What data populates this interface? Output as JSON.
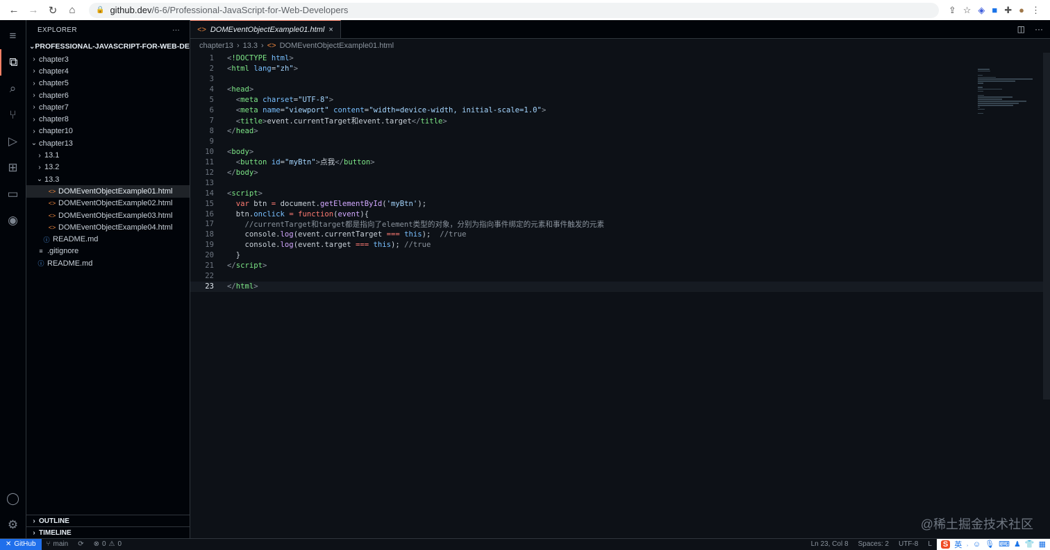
{
  "browser": {
    "url_host": "github.dev",
    "url_path": "/6-6/Professional-JavaScript-for-Web-Developers"
  },
  "sidebar": {
    "title": "EXPLORER",
    "more": "···",
    "root": "PROFESSIONAL-JAVASCRIPT-FOR-WEB-DEVE...",
    "items": [
      {
        "label": "chapter3",
        "type": "folder",
        "open": false,
        "depth": 1
      },
      {
        "label": "chapter4",
        "type": "folder",
        "open": false,
        "depth": 1
      },
      {
        "label": "chapter5",
        "type": "folder",
        "open": false,
        "depth": 1
      },
      {
        "label": "chapter6",
        "type": "folder",
        "open": false,
        "depth": 1
      },
      {
        "label": "chapter7",
        "type": "folder",
        "open": false,
        "depth": 1
      },
      {
        "label": "chapter8",
        "type": "folder",
        "open": false,
        "depth": 1
      },
      {
        "label": "chapter10",
        "type": "folder",
        "open": false,
        "depth": 1
      },
      {
        "label": "chapter13",
        "type": "folder",
        "open": true,
        "depth": 1
      },
      {
        "label": "13.1",
        "type": "folder",
        "open": false,
        "depth": 2
      },
      {
        "label": "13.2",
        "type": "folder",
        "open": false,
        "depth": 2
      },
      {
        "label": "13.3",
        "type": "folder",
        "open": true,
        "depth": 2
      },
      {
        "label": "DOMEventObjectExample01.html",
        "type": "html",
        "depth": 3,
        "selected": true
      },
      {
        "label": "DOMEventObjectExample02.html",
        "type": "html",
        "depth": 3
      },
      {
        "label": "DOMEventObjectExample03.html",
        "type": "html",
        "depth": 3
      },
      {
        "label": "DOMEventObjectExample04.html",
        "type": "html",
        "depth": 3
      },
      {
        "label": "README.md",
        "type": "info",
        "depth": 2
      },
      {
        "label": ".gitignore",
        "type": "lines",
        "depth": 1
      },
      {
        "label": "README.md",
        "type": "info",
        "depth": 1
      }
    ],
    "outline": "OUTLINE",
    "timeline": "TIMELINE"
  },
  "editor": {
    "tab": "DOMEventObjectExample01.html",
    "breadcrumbs": [
      "chapter13",
      "13.3",
      "DOMEventObjectExample01.html"
    ],
    "current_line": 23,
    "lines": [
      [
        [
          "br",
          "<"
        ],
        [
          "tag",
          "!DOCTYPE"
        ],
        [
          "p",
          " "
        ],
        [
          "attr",
          "html"
        ],
        [
          "br",
          ">"
        ]
      ],
      [
        [
          "br",
          "<"
        ],
        [
          "tag",
          "html"
        ],
        [
          "p",
          " "
        ],
        [
          "attr",
          "lang"
        ],
        [
          "p",
          "="
        ],
        [
          "str",
          "\"zh\""
        ],
        [
          "br",
          ">"
        ]
      ],
      [],
      [
        [
          "br",
          "<"
        ],
        [
          "tag",
          "head"
        ],
        [
          "br",
          ">"
        ]
      ],
      [
        [
          "p",
          "  "
        ],
        [
          "br",
          "<"
        ],
        [
          "tag",
          "meta"
        ],
        [
          "p",
          " "
        ],
        [
          "attr",
          "charset"
        ],
        [
          "p",
          "="
        ],
        [
          "str",
          "\"UTF-8\""
        ],
        [
          "br",
          ">"
        ]
      ],
      [
        [
          "p",
          "  "
        ],
        [
          "br",
          "<"
        ],
        [
          "tag",
          "meta"
        ],
        [
          "p",
          " "
        ],
        [
          "attr",
          "name"
        ],
        [
          "p",
          "="
        ],
        [
          "str",
          "\"viewport\""
        ],
        [
          "p",
          " "
        ],
        [
          "attr",
          "content"
        ],
        [
          "p",
          "="
        ],
        [
          "str",
          "\"width=device-width, initial-scale=1.0\""
        ],
        [
          "br",
          ">"
        ]
      ],
      [
        [
          "p",
          "  "
        ],
        [
          "br",
          "<"
        ],
        [
          "tag",
          "title"
        ],
        [
          "br",
          ">"
        ],
        [
          "p",
          "event.currentTarget和event.target"
        ],
        [
          "br",
          "</"
        ],
        [
          "tag",
          "title"
        ],
        [
          "br",
          ">"
        ]
      ],
      [
        [
          "br",
          "</"
        ],
        [
          "tag",
          "head"
        ],
        [
          "br",
          ">"
        ]
      ],
      [],
      [
        [
          "br",
          "<"
        ],
        [
          "tag",
          "body"
        ],
        [
          "br",
          ">"
        ]
      ],
      [
        [
          "p",
          "  "
        ],
        [
          "br",
          "<"
        ],
        [
          "tag",
          "button"
        ],
        [
          "p",
          " "
        ],
        [
          "attr",
          "id"
        ],
        [
          "p",
          "="
        ],
        [
          "str",
          "\"myBtn\""
        ],
        [
          "br",
          ">"
        ],
        [
          "p",
          "点我"
        ],
        [
          "br",
          "</"
        ],
        [
          "tag",
          "button"
        ],
        [
          "br",
          ">"
        ]
      ],
      [
        [
          "br",
          "</"
        ],
        [
          "tag",
          "body"
        ],
        [
          "br",
          ">"
        ]
      ],
      [],
      [
        [
          "br",
          "<"
        ],
        [
          "tag",
          "script"
        ],
        [
          "br",
          ">"
        ]
      ],
      [
        [
          "p",
          "  "
        ],
        [
          "kw",
          "var"
        ],
        [
          "p",
          " btn "
        ],
        [
          "kw",
          "="
        ],
        [
          "p",
          " document."
        ],
        [
          "fn",
          "getElementById"
        ],
        [
          "p",
          "("
        ],
        [
          "str",
          "'myBtn'"
        ],
        [
          "p",
          ");"
        ]
      ],
      [
        [
          "p",
          "  btn."
        ],
        [
          "attr",
          "onclick"
        ],
        [
          "p",
          " "
        ],
        [
          "kw",
          "="
        ],
        [
          "p",
          " "
        ],
        [
          "kw",
          "function"
        ],
        [
          "p",
          "("
        ],
        [
          "fn",
          "event"
        ],
        [
          "p",
          "){"
        ]
      ],
      [
        [
          "p",
          "    "
        ],
        [
          "com",
          "//currentTarget和target都是指向了element类型的对象，分别为指向事件绑定的元素和事件触发的元素"
        ]
      ],
      [
        [
          "p",
          "    console."
        ],
        [
          "fn",
          "log"
        ],
        [
          "p",
          "(event.currentTarget "
        ],
        [
          "kw",
          "==="
        ],
        [
          "p",
          " "
        ],
        [
          "attr",
          "this"
        ],
        [
          "p",
          ");  "
        ],
        [
          "com",
          "//true"
        ]
      ],
      [
        [
          "p",
          "    console."
        ],
        [
          "fn",
          "log"
        ],
        [
          "p",
          "(event.target "
        ],
        [
          "kw",
          "==="
        ],
        [
          "p",
          " "
        ],
        [
          "attr",
          "this"
        ],
        [
          "p",
          "); "
        ],
        [
          "com",
          "//true"
        ]
      ],
      [
        [
          "p",
          "  }"
        ]
      ],
      [
        [
          "br",
          "</"
        ],
        [
          "tag",
          "script"
        ],
        [
          "br",
          ">"
        ]
      ],
      [],
      [
        [
          "br",
          "</"
        ],
        [
          "tag",
          "html"
        ],
        [
          "br",
          ">"
        ]
      ]
    ]
  },
  "status": {
    "remote": "GitHub",
    "branch": "main",
    "errors": "0",
    "warnings": "0",
    "position": "Ln 23, Col 8",
    "spaces": "Spaces: 2",
    "encoding": "UTF-8",
    "eol": "L",
    "ime_lang": "英"
  },
  "watermark": "@稀土掘金技术社区"
}
